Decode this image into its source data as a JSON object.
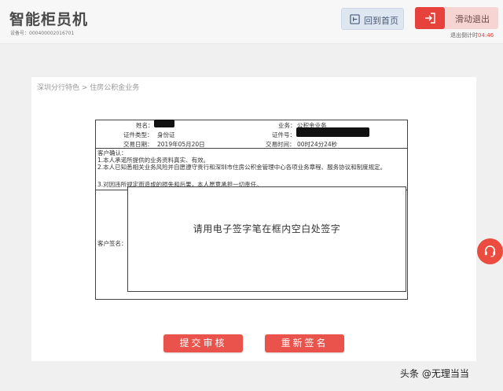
{
  "header": {
    "title": "智能柜员机",
    "device_no": "设备号：000400002016701",
    "home_label": "回到首页",
    "logout_label": "滑动退出",
    "countdown_prefix": "退出倒计时",
    "countdown_value": "04:46"
  },
  "breadcrumb": "深圳分行特色 > 住房公积金业务",
  "form": {
    "name_label": "姓名：",
    "business_label": "业务：",
    "business_value": "公积金业务",
    "id_type_label": "证件类型：",
    "id_type_value": "身份证",
    "id_no_label": "证件号：",
    "date_label": "交易日期：",
    "date_value": "2019年05月20日",
    "time_label": "交易时间：",
    "time_value": "00时24分24秒",
    "confirm_title": "客户确认：",
    "confirm_1": "1.本人承诺所提供的业务资料真实、有效。",
    "confirm_2": "2.本人已知悉相关业务风险并自愿遵守贵行和深圳市住房公积金管理中心各项业务章程、服务协议和制度规定。",
    "confirm_3": "3.对因违所规定而造成的损失和后果，本人愿意承担一切责任。",
    "sig_label": "客户签名：",
    "sig_hint": "请用电子签字笔在框内空白处签字"
  },
  "buttons": {
    "submit": "提交审核",
    "resign": "重新签名"
  },
  "watermark": "头条 @无理当当",
  "colors": {
    "accent": "#e9534b",
    "home_bg": "#dde6f1",
    "logout_bg": "#f6d4d2"
  },
  "icons": {
    "home": "home-icon",
    "logout": "logout-icon",
    "support": "headset-icon"
  }
}
